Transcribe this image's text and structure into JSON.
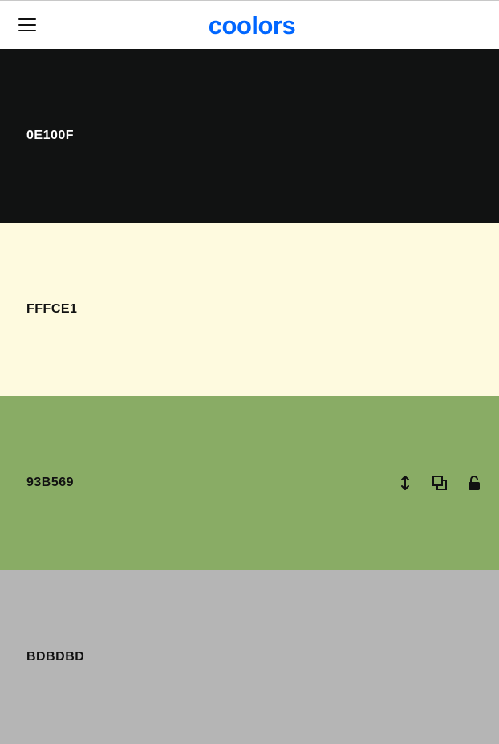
{
  "header": {
    "logo_text": "coolors",
    "logo_color": "#0066FF",
    "menu_icon": "hamburger-menu-icon"
  },
  "palette": {
    "swatches": [
      {
        "hex": "0E100F",
        "color": "#111212",
        "text_color": "#ffffff"
      },
      {
        "hex": "FFFCE1",
        "color": "#FEFADF",
        "text_color": "#111111"
      },
      {
        "hex": "93B569",
        "color": "#89AC65",
        "text_color": "#111111",
        "tools": [
          "drag-vertical-icon",
          "copy-icon",
          "unlock-icon"
        ]
      },
      {
        "hex": "BDBDBD",
        "color": "#B5B5B5",
        "text_color": "#111111"
      }
    ]
  }
}
